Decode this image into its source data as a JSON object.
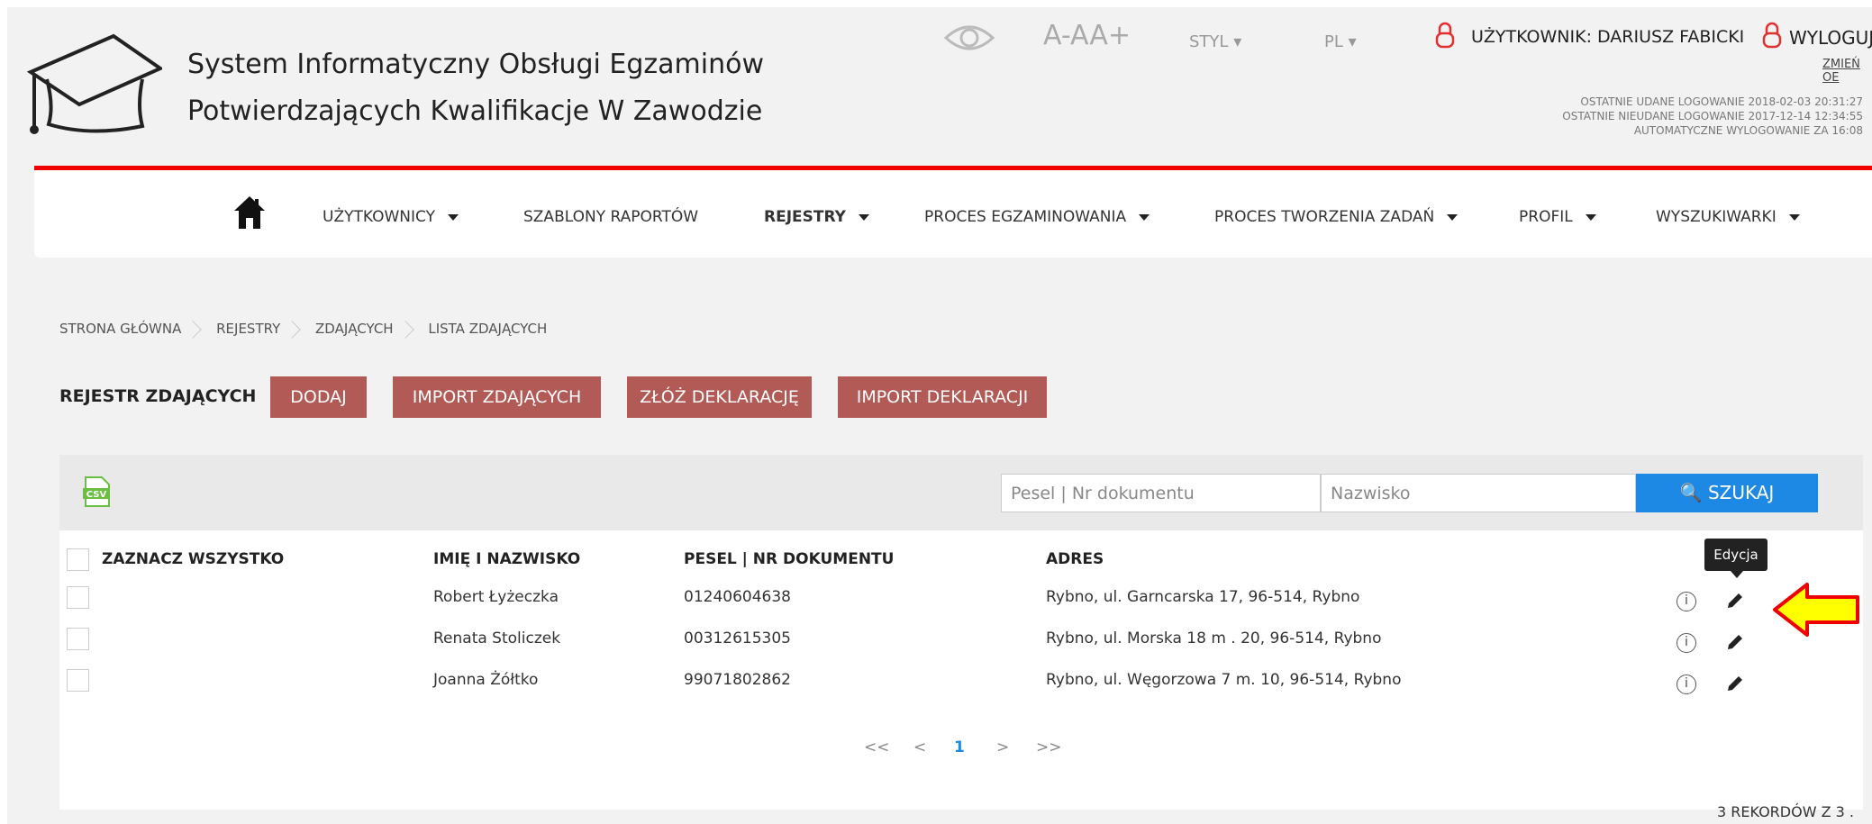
{
  "header": {
    "title_line1": "System Informatyczny Obsługi Egzaminów",
    "title_line2": "Potwierdzających Kwalifikacje W Zawodzie",
    "font_size_control": "A-AA+",
    "style_label": "STYL",
    "lang_label": "PL",
    "user_label": "UŻYTKOWNIK: DARIUSZ FABICKI",
    "logout_label": "WYLOGUJ",
    "change_label": "ZMIEŃ OE",
    "last_ok_login": "OSTATNIE UDANE LOGOWANIE 2018-02-03 20:31:27",
    "last_failed_login": "OSTATNIE NIEUDANE LOGOWANIE 2017-12-14 12:34:55",
    "auto_logout": "AUTOMATYCZNE WYLOGOWANIE ZA 16:08"
  },
  "nav": {
    "items": [
      {
        "label": "UŻYTKOWNICY"
      },
      {
        "label": "SZABLONY RAPORTÓW"
      },
      {
        "label": "REJESTRY"
      },
      {
        "label": "PROCES EGZAMINOWANIA"
      },
      {
        "label": "PROCES TWORZENIA ZADAŃ"
      },
      {
        "label": "PROFIL"
      },
      {
        "label": "WYSZUKIWARKI"
      }
    ]
  },
  "breadcrumb": [
    "STRONA GŁÓWNA",
    "REJESTRY",
    "ZDAJĄCYCH",
    "LISTA ZDAJĄCYCH"
  ],
  "register": {
    "title": "REJESTR ZDAJĄCYCH",
    "buttons": [
      {
        "label": "DODAJ"
      },
      {
        "label": "IMPORT ZDAJĄCYCH"
      },
      {
        "label": "ZŁÓŻ DEKLARACJĘ"
      },
      {
        "label": "IMPORT DEKLARACJI"
      }
    ]
  },
  "search": {
    "csv_label": "CSV",
    "pesel_placeholder": "Pesel | Nr dokumentu",
    "surname_placeholder": "Nazwisko",
    "button_label": "SZUKAJ"
  },
  "table": {
    "select_all": "ZAZNACZ WSZYSTKO",
    "headers": [
      "IMIĘ I NAZWISKO",
      "PESEL | NR DOKUMENTU",
      "ADRES"
    ],
    "rows": [
      {
        "name": "Robert Łyżeczka",
        "pesel": "01240604638",
        "address": "Rybno, ul. Garncarska 17, 96-514, Rybno"
      },
      {
        "name": "Renata Stoliczek",
        "pesel": "00312615305",
        "address": "Rybno, ul. Morska 18 m . 20, 96-514, Rybno"
      },
      {
        "name": "Joanna Żółtko",
        "pesel": "99071802862",
        "address": "Rybno, ul. Węgorzowa 7 m. 10, 96-514, Rybno"
      }
    ],
    "tooltip": "Edycja",
    "info_glyph": "i"
  },
  "pagination": {
    "first": "<<",
    "prev": "<",
    "current": "1",
    "next": ">",
    "last": ">>"
  },
  "records": "3 REKORDÓW Z 3 .",
  "colors": {
    "accent_red": "#e00000",
    "button_bg": "#b15a56",
    "search_blue": "#1e88e5",
    "arrow_yellow": "#ffff00"
  }
}
